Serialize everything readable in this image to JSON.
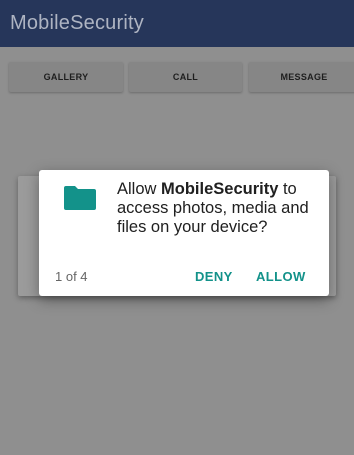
{
  "app": {
    "title": "MobileSecurity"
  },
  "buttons": {
    "gallery": "GALLERY",
    "call": "CALL",
    "message": "MESSAGE"
  },
  "dialog": {
    "icon": "folder-icon",
    "message_prefix": "Allow ",
    "app_name": "MobileSecurity",
    "message_suffix": " to access photos, media and files on your device?",
    "counter": "1 of 4",
    "deny_label": "DENY",
    "allow_label": "ALLOW"
  },
  "colors": {
    "appbar": "#26365a",
    "accent": "#13928a",
    "scrim": "#8f8f8f"
  }
}
